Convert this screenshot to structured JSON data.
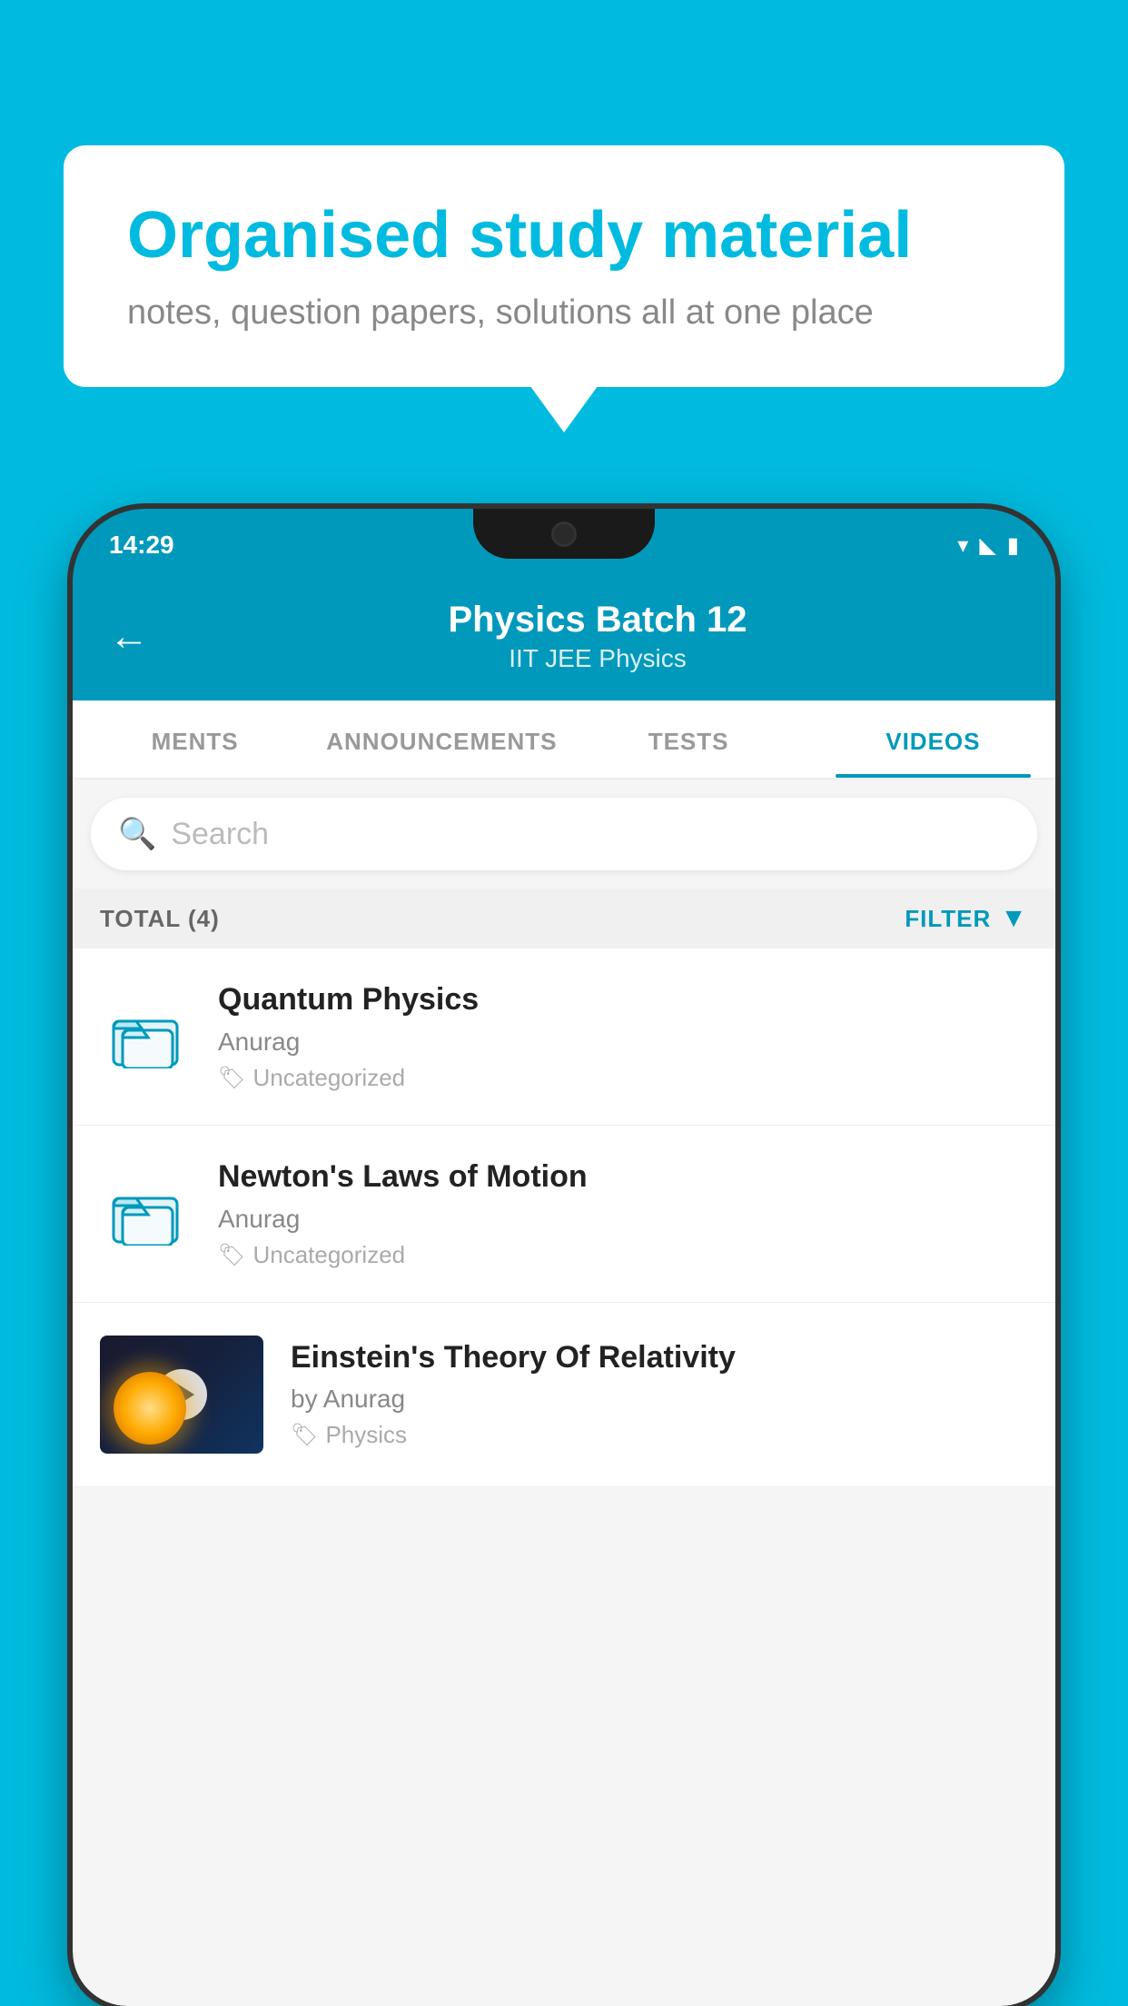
{
  "background": {
    "color": "#00BBDF"
  },
  "speech_bubble": {
    "title": "Organised study material",
    "subtitle": "notes, question papers, solutions all at one place"
  },
  "phone": {
    "status_bar": {
      "time": "14:29"
    },
    "header": {
      "back_label": "←",
      "title": "Physics Batch 12",
      "subtitle": "IIT JEE   Physics"
    },
    "tabs": [
      {
        "label": "MENTS",
        "active": false
      },
      {
        "label": "ANNOUNCEMENTS",
        "active": false
      },
      {
        "label": "TESTS",
        "active": false
      },
      {
        "label": "VIDEOS",
        "active": true
      }
    ],
    "search": {
      "placeholder": "Search"
    },
    "filter_row": {
      "total_label": "TOTAL (4)",
      "filter_label": "FILTER"
    },
    "videos": [
      {
        "id": "v1",
        "title": "Quantum Physics",
        "author": "Anurag",
        "tag": "Uncategorized",
        "has_thumb": false
      },
      {
        "id": "v2",
        "title": "Newton's Laws of Motion",
        "author": "Anurag",
        "tag": "Uncategorized",
        "has_thumb": false
      },
      {
        "id": "v3",
        "title": "Einstein's Theory Of Relativity",
        "author": "by Anurag",
        "tag": "Physics",
        "has_thumb": true
      }
    ]
  }
}
